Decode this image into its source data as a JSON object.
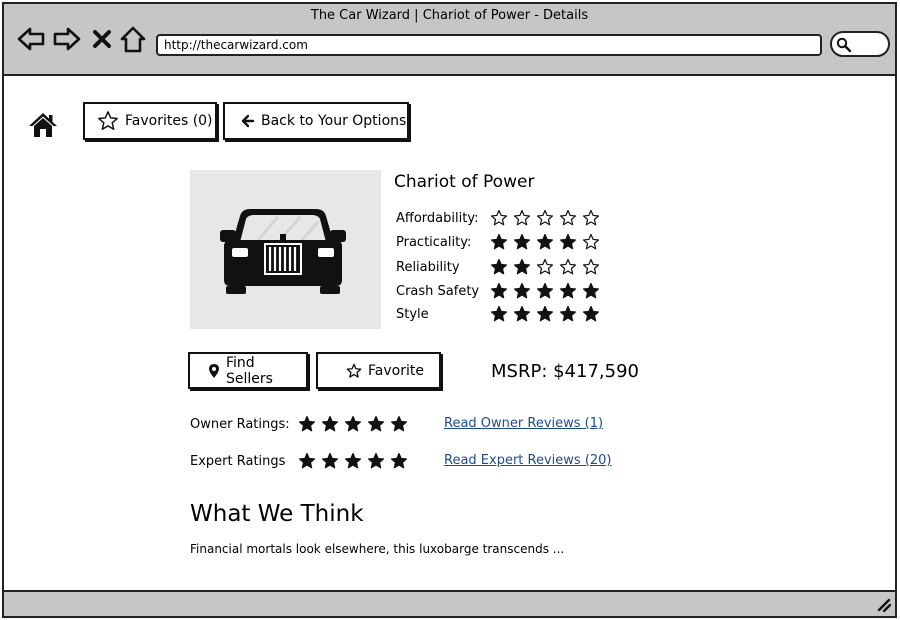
{
  "window": {
    "title": "The Car Wizard | Chariot of Power - Details",
    "url": "http://thecarwizard.com"
  },
  "toolbar": {
    "favorites_label": "Favorites (0)",
    "back_label": "Back to Your Options"
  },
  "car": {
    "name": "Chariot of Power",
    "ratings": [
      {
        "label": "Affordability:",
        "stars": 0
      },
      {
        "label": "Practicality:",
        "stars": 4
      },
      {
        "label": "Reliability",
        "stars": 2
      },
      {
        "label": "Crash Safety",
        "stars": 5
      },
      {
        "label": "Style",
        "stars": 5
      }
    ],
    "msrp": "MSRP: $417,590"
  },
  "actions": {
    "find_sellers_label": "Find Sellers",
    "favorite_label": "Favorite"
  },
  "reviews": {
    "owner_label": "Owner Ratings:",
    "owner_stars": 5,
    "owner_link": "Read Owner Reviews (1)",
    "expert_label": "Expert Ratings",
    "expert_stars": 5,
    "expert_link": "Read Expert Reviews (20)"
  },
  "summary": {
    "heading": "What We Think",
    "text": "Financial mortals look elsewhere, this luxobarge transcends ..."
  }
}
